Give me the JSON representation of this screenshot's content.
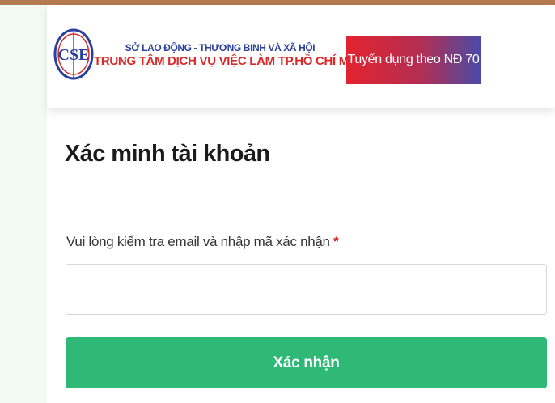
{
  "header": {
    "logo_text": "CSE",
    "org_parent": "SỞ LAO ĐỘNG - THƯƠNG BINH VÀ XÃ HỘI",
    "org_name": "TRUNG TÂM DỊCH VỤ VIỆC LÀM TP.HỒ CHÍ MINH",
    "banner_label": "Tuyển dụng theo NĐ 70"
  },
  "form": {
    "title": "Xác minh tài khoản",
    "field_label": "Vui lòng kiểm tra email và nhập mã xác nhận",
    "required_mark": "*",
    "code_value": "",
    "submit_label": "Xác nhận"
  },
  "colors": {
    "accent_green": "#2eb976",
    "brand_red": "#d92a2a",
    "brand_blue": "#2b3f9e"
  }
}
